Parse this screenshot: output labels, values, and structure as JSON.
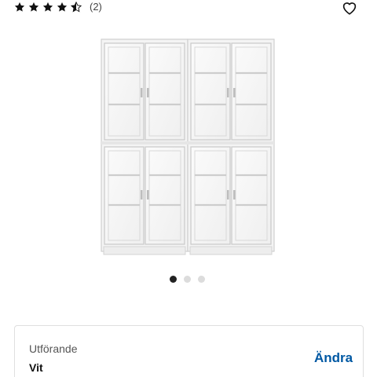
{
  "rating": {
    "stars_value": 4.5,
    "stars_max": 5,
    "review_count": "(2)"
  },
  "favorite": {
    "icon": "heart-outline-icon"
  },
  "product_image": {
    "icon": "glass-door-bookcase-image",
    "alt": ""
  },
  "carousel": {
    "total": 3,
    "active_index": 0
  },
  "variant": {
    "label": "Utförande",
    "value": "Vit",
    "change_label": "Ändra"
  },
  "colors": {
    "accent": "#0058a3",
    "star": "#111111",
    "dot_active": "#222222",
    "dot_inactive": "#dcdcdc"
  }
}
